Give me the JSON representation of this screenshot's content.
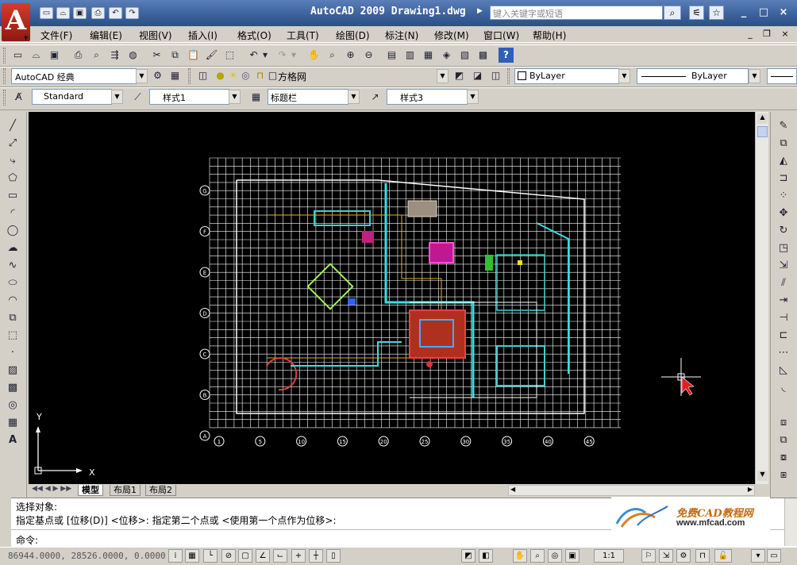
{
  "window": {
    "title": "AutoCAD 2009 Drawing1.dwg",
    "help_search_placeholder": "键入关键字或短语",
    "controls": [
      "_",
      "□",
      "×"
    ],
    "doc_controls": [
      "_",
      "❐",
      "×"
    ]
  },
  "menu": [
    "文件(F)",
    "编辑(E)",
    "视图(V)",
    "插入(I)",
    "格式(O)",
    "工具(T)",
    "绘图(D)",
    "标注(N)",
    "修改(M)",
    "窗口(W)",
    "帮助(H)"
  ],
  "workspace": {
    "value": "AutoCAD 经典"
  },
  "layer": {
    "value": "方格网"
  },
  "color": {
    "value": "ByLayer"
  },
  "linetype": {
    "value": "ByLayer"
  },
  "styles": {
    "text_style": "Standard",
    "dim_style": "样式1",
    "table_style": "标题栏",
    "multileader_style": "样式3"
  },
  "drawing": {
    "row_labels": [
      "G",
      "F",
      "E",
      "D",
      "C",
      "B",
      "A"
    ],
    "col_labels": [
      "1",
      "5",
      "10",
      "15",
      "20",
      "25",
      "30",
      "35",
      "40",
      "45"
    ],
    "ucs_x": "X",
    "ucs_y": "Y"
  },
  "layout_tabs": {
    "model": "模型",
    "layout1": "布局1",
    "layout2": "布局2"
  },
  "command": {
    "line1": "选择对象:",
    "line2": "指定基点或 [位移(D)] <位移>:  指定第二个点或 <使用第一个点作为位移>:",
    "prompt": "命令:"
  },
  "status": {
    "coordinates": "86944.0000, 28526.0000, 0.0000",
    "annotation_scale": "1:1"
  },
  "watermark": {
    "title": "免费CAD教程网",
    "url": "www.mfcad.com"
  }
}
